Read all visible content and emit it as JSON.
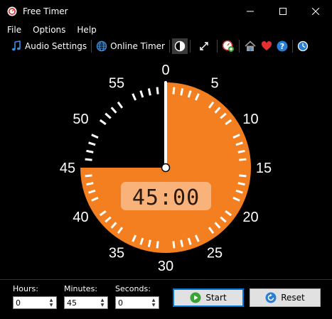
{
  "window": {
    "title": "Free Timer"
  },
  "menu": {
    "items": [
      "File",
      "Options",
      "Help"
    ]
  },
  "toolbar": {
    "audio_label": "Audio Settings",
    "online_label": "Online Timer"
  },
  "clock": {
    "display": "45:00",
    "numbers": [
      "0",
      "5",
      "10",
      "15",
      "20",
      "25",
      "30",
      "35",
      "40",
      "45",
      "50",
      "55"
    ],
    "remaining_minutes": 45,
    "colors": {
      "fill": "#f47f20",
      "display_bg": "#f9b27a",
      "display_text": "#2b1a0a",
      "ticks": "#ffffff",
      "bg": "#000000"
    }
  },
  "controls": {
    "hours": {
      "label": "Hours:",
      "value": "0"
    },
    "minutes": {
      "label": "Minutes:",
      "value": "45"
    },
    "seconds": {
      "label": "Seconds:",
      "value": "0"
    },
    "start_label": "Start",
    "reset_label": "Reset"
  }
}
